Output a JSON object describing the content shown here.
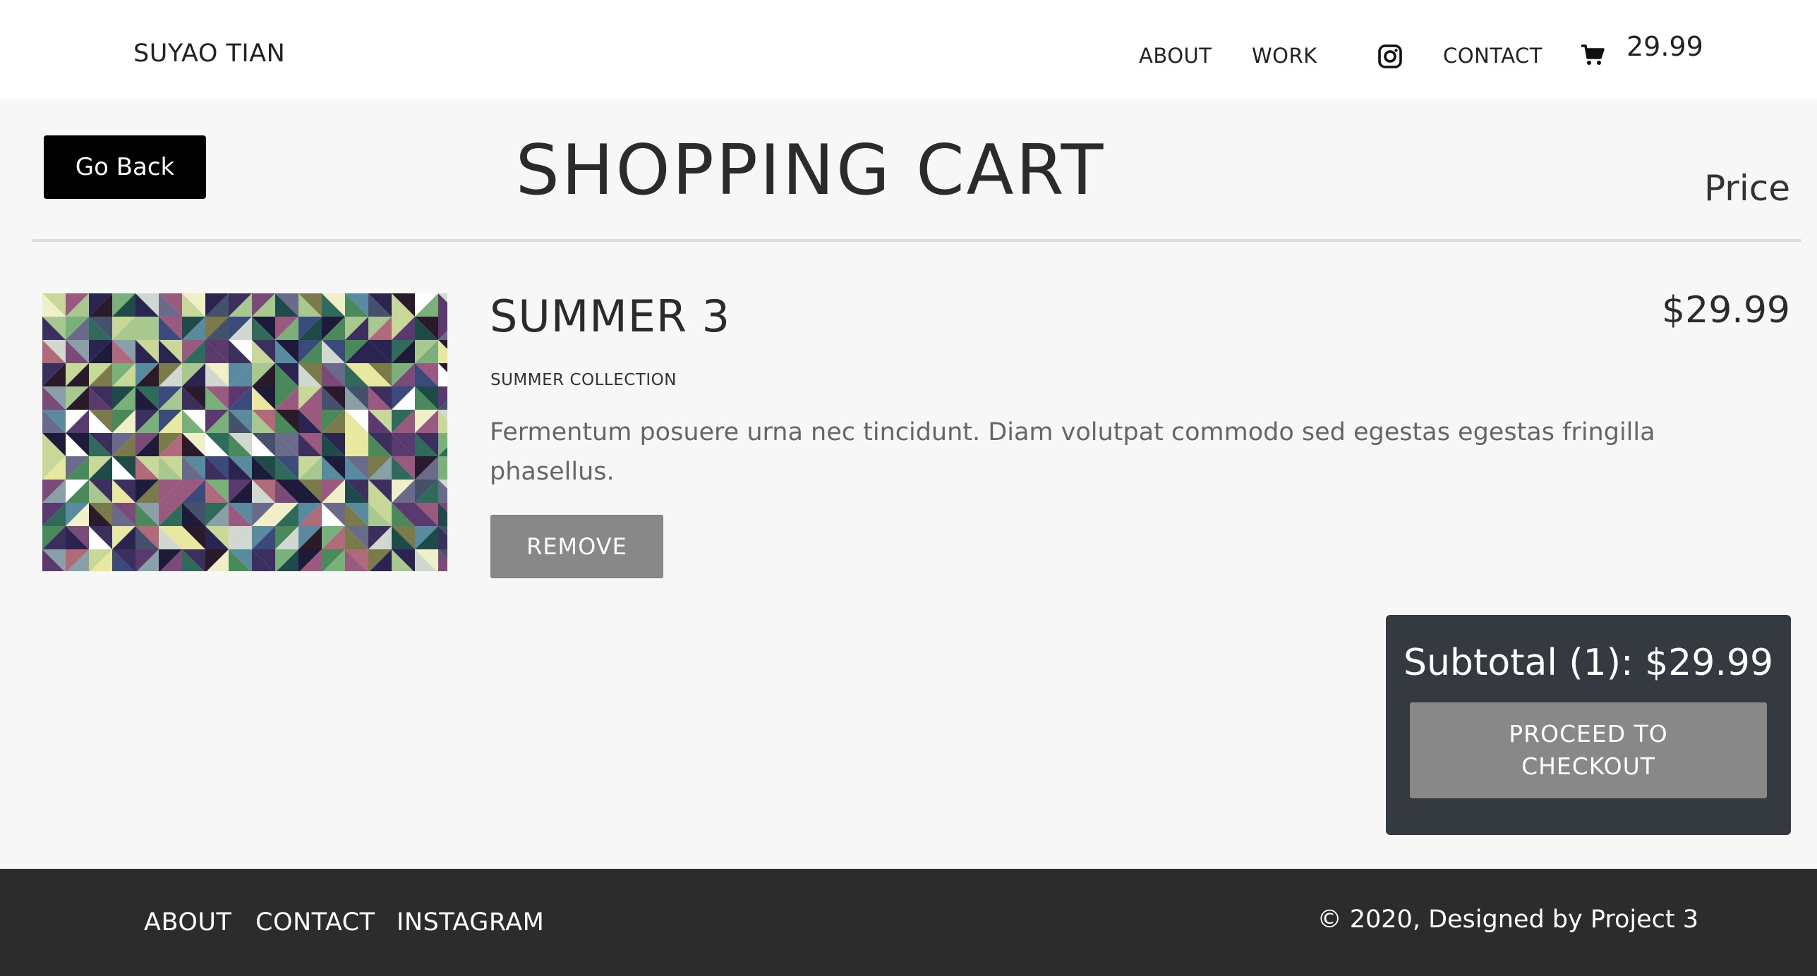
{
  "header": {
    "brand": "SUYAO TIAN",
    "nav": {
      "about": "ABOUT",
      "work": "WORK",
      "contact": "CONTACT"
    },
    "cart_total": "29.99",
    "icons": [
      "instagram-icon",
      "cart-icon"
    ]
  },
  "cart": {
    "back_label": "Go Back",
    "title": "SHOPPING CART",
    "price_heading": "Price",
    "items": [
      {
        "name": "SUMMER 3",
        "collection": "SUMMER COLLECTION",
        "description": "Fermentum posuere urna nec tincidunt. Diam volutpat commodo sed egestas egestas fringilla phasellus.",
        "price": "$29.99",
        "remove_label": "REMOVE"
      }
    ],
    "subtotal": "Subtotal (1): $29.99",
    "checkout_label": "PROCEED TO CHECKOUT"
  },
  "footer": {
    "about": "ABOUT",
    "contact": "CONTACT",
    "instagram": "INSTAGRAM",
    "copyright": "© 2020, Designed by Project 3"
  },
  "colors": {
    "header_bg": "#ffffff",
    "page_bg": "#f7f7f7",
    "button_primary": "#000000",
    "button_secondary": "#888888",
    "summary_bg": "#343a40",
    "footer_bg": "#2c2c2c"
  }
}
